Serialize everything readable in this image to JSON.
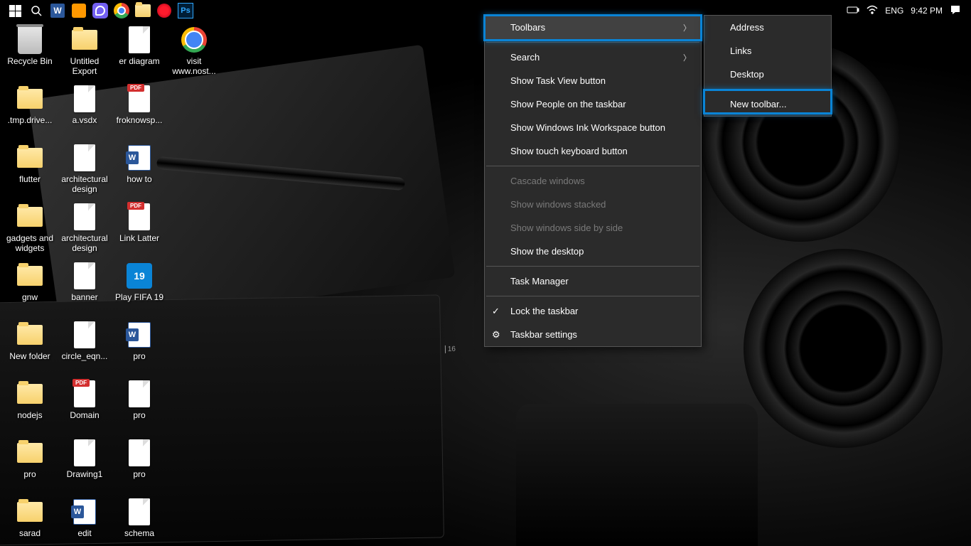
{
  "taskbar": {
    "system": {
      "language": "ENG",
      "time": "9:42 PM"
    }
  },
  "desktop_icons": [
    {
      "label": "Recycle Bin",
      "type": "bin",
      "col": 0,
      "row": 0
    },
    {
      "label": "Untitled Export",
      "type": "folder",
      "col": 1,
      "row": 0
    },
    {
      "label": "er diagram",
      "type": "file",
      "col": 2,
      "row": 0
    },
    {
      "label": "visit www.nost...",
      "type": "chrome",
      "col": 3,
      "row": 0
    },
    {
      "label": ".tmp.drive...",
      "type": "folder",
      "col": 0,
      "row": 1
    },
    {
      "label": "a.vsdx",
      "type": "file",
      "col": 1,
      "row": 1
    },
    {
      "label": "froknowsp...",
      "type": "pdf",
      "col": 2,
      "row": 1
    },
    {
      "label": "flutter",
      "type": "folder",
      "col": 0,
      "row": 2
    },
    {
      "label": "architectural design",
      "type": "file",
      "col": 1,
      "row": 2
    },
    {
      "label": "how to",
      "type": "word",
      "col": 2,
      "row": 2
    },
    {
      "label": "gadgets and widgets",
      "type": "folder",
      "col": 0,
      "row": 3
    },
    {
      "label": "architectural design",
      "type": "file",
      "col": 1,
      "row": 3
    },
    {
      "label": "Link Latter",
      "type": "pdf",
      "col": 2,
      "row": 3
    },
    {
      "label": "gnw",
      "type": "folder",
      "col": 0,
      "row": 4
    },
    {
      "label": "banner",
      "type": "file",
      "col": 1,
      "row": 4
    },
    {
      "label": "Play FIFA 19",
      "type": "fifa",
      "col": 2,
      "row": 4
    },
    {
      "label": "New folder",
      "type": "folder",
      "col": 0,
      "row": 5
    },
    {
      "label": "circle_eqn...",
      "type": "file",
      "col": 1,
      "row": 5
    },
    {
      "label": "pro",
      "type": "word",
      "col": 2,
      "row": 5
    },
    {
      "label": "nodejs",
      "type": "folder",
      "col": 0,
      "row": 6
    },
    {
      "label": "Domain",
      "type": "pdf",
      "col": 1,
      "row": 6
    },
    {
      "label": "pro",
      "type": "file",
      "col": 2,
      "row": 6
    },
    {
      "label": "pro",
      "type": "folder",
      "col": 0,
      "row": 7
    },
    {
      "label": "Drawing1",
      "type": "file",
      "col": 1,
      "row": 7
    },
    {
      "label": "pro",
      "type": "file",
      "col": 2,
      "row": 7
    },
    {
      "label": "sarad",
      "type": "folder",
      "col": 0,
      "row": 8
    },
    {
      "label": "edit",
      "type": "word",
      "col": 1,
      "row": 8
    },
    {
      "label": "schema",
      "type": "file",
      "col": 2,
      "row": 8
    }
  ],
  "context_menu_1": [
    {
      "label": "Toolbars",
      "submenu": true,
      "hover": true
    },
    {
      "sep": true
    },
    {
      "label": "Search",
      "submenu": true
    },
    {
      "label": "Show Task View button"
    },
    {
      "label": "Show People on the taskbar"
    },
    {
      "label": "Show Windows Ink Workspace button"
    },
    {
      "label": "Show touch keyboard button"
    },
    {
      "sep": true
    },
    {
      "label": "Cascade windows",
      "disabled": true
    },
    {
      "label": "Show windows stacked",
      "disabled": true
    },
    {
      "label": "Show windows side by side",
      "disabled": true
    },
    {
      "label": "Show the desktop"
    },
    {
      "sep": true
    },
    {
      "label": "Task Manager"
    },
    {
      "sep": true
    },
    {
      "label": "Lock the taskbar",
      "icon": "check"
    },
    {
      "label": "Taskbar settings",
      "icon": "gear"
    }
  ],
  "context_menu_2": [
    {
      "label": "Address"
    },
    {
      "label": "Links"
    },
    {
      "label": "Desktop"
    },
    {
      "sep": true
    },
    {
      "label": "New toolbar..."
    }
  ]
}
